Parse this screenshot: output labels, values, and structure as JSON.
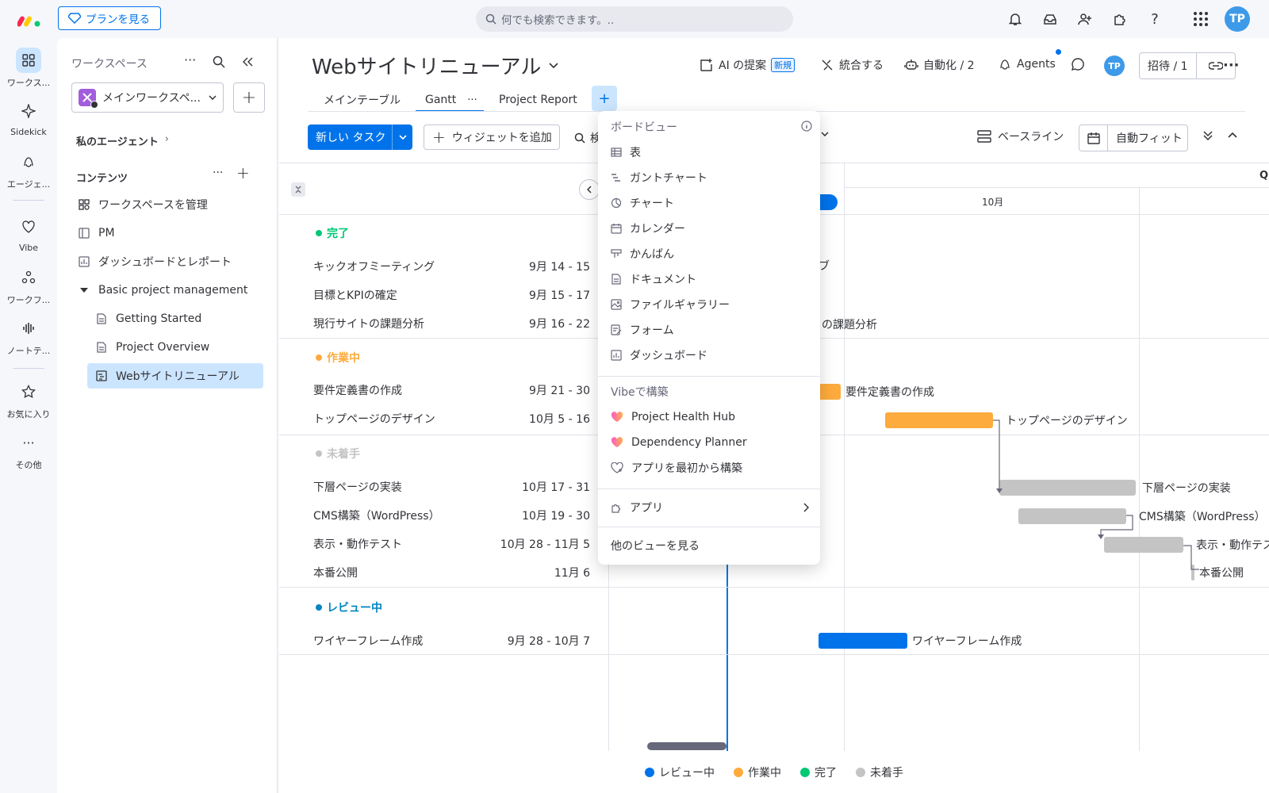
{
  "colors": {
    "accent": "#0073ea",
    "done": "#00c875",
    "working": "#fdab3d",
    "not_started": "#c4c4c4",
    "review": "#0086c0",
    "today_line": "#0073ea"
  },
  "topbar": {
    "plan_label": "プランを見る",
    "search_placeholder": "何でも検索できます。..",
    "avatar": "TP"
  },
  "rail": {
    "items": [
      {
        "label": "ワークス...",
        "icon": "workspace-icon"
      },
      {
        "label": "Sidekick",
        "icon": "sidekick-icon"
      },
      {
        "label": "エージェ...",
        "icon": "agent-icon"
      },
      {
        "label": "Vibe",
        "icon": "vibe-icon"
      },
      {
        "label": "ワークフ...",
        "icon": "workflow-icon"
      },
      {
        "label": "ノートテ...",
        "icon": "notetaker-icon"
      },
      {
        "label": "お気に入り",
        "icon": "star-icon"
      },
      {
        "label": "その他",
        "icon": "more-icon"
      }
    ]
  },
  "sidebar": {
    "title": "ワークスペース",
    "workspace_name": "メインワークスペ...",
    "my_agents": "私のエージェント",
    "content_label": "コンテンツ",
    "items": [
      {
        "label": "ワークスペースを管理",
        "icon": "manage-icon"
      },
      {
        "label": "PM",
        "icon": "board-icon"
      },
      {
        "label": "ダッシュボードとレポート",
        "icon": "dashboard-icon"
      },
      {
        "label": "Basic project management",
        "icon": "caret-down-icon"
      },
      {
        "label": "Getting Started",
        "icon": "doc-icon"
      },
      {
        "label": "Project Overview",
        "icon": "doc-icon"
      },
      {
        "label": "Webサイトリニューアル",
        "icon": "gantt-board-icon"
      }
    ]
  },
  "board": {
    "title": "Webサイトリニューアル",
    "ai_label": "AI の提案",
    "new_badge": "新規",
    "integrate_label": "統合する",
    "automate_label": "自動化 / 2",
    "agents_label": "Agents",
    "invite_label": "招待 / 1",
    "tabs": [
      "メインテーブル",
      "Gantt",
      "Project Report"
    ],
    "new_task": "新しい タスク",
    "add_widget": "ウィジェットを追加",
    "search_partial": "検",
    "baseline": "ベースライン",
    "autofit": "自動フィット",
    "month_label": "10月",
    "quarter_partial": "Q"
  },
  "groups": [
    {
      "name": "完了",
      "color": "#00c875",
      "tasks": [
        {
          "name": "キックオフミーティング",
          "date": "9月 14 - 15",
          "bar_label": "ブ"
        },
        {
          "name": "目標とKPIの確定",
          "date": "9月 15 - 17",
          "bar_label": ""
        },
        {
          "name": "現行サイトの課題分析",
          "date": "9月 16 - 22",
          "bar_label": "トの課題分析"
        }
      ]
    },
    {
      "name": "作業中",
      "color": "#fdab3d",
      "tasks": [
        {
          "name": "要件定義書の作成",
          "date": "9月 21 - 30",
          "bar_label": "要件定義書の作成"
        },
        {
          "name": "トップページのデザイン",
          "date": "10月 5 - 16",
          "bar_label": "トップページのデザイン"
        }
      ]
    },
    {
      "name": "未着手",
      "color": "#c4c4c4",
      "tasks": [
        {
          "name": "下層ページの実装",
          "date": "10月 17 - 31",
          "bar_label": "下層ページの実装"
        },
        {
          "name": "CMS構築（WordPress）",
          "date": "10月 19 - 30",
          "bar_label": "CMS構築（WordPress）"
        },
        {
          "name": "表示・動作テスト",
          "date": "10月 28 - 11月 5",
          "bar_label": "表示・動作テス"
        },
        {
          "name": "本番公開",
          "date": "11月 6",
          "bar_label": "本番公開"
        }
      ]
    },
    {
      "name": "レビュー中",
      "color": "#0086c0",
      "tasks": [
        {
          "name": "ワイヤーフレーム作成",
          "date": "9月 28 - 10月 7",
          "bar_label": "ワイヤーフレーム作成"
        }
      ]
    }
  ],
  "dropdown": {
    "board_views_title": "ボードビュー",
    "views": [
      {
        "label": "表",
        "icon": "table-icon"
      },
      {
        "label": "ガントチャート",
        "icon": "gantt-icon"
      },
      {
        "label": "チャート",
        "icon": "chart-icon"
      },
      {
        "label": "カレンダー",
        "icon": "calendar-icon"
      },
      {
        "label": "かんばん",
        "icon": "kanban-icon"
      },
      {
        "label": "ドキュメント",
        "icon": "document-icon"
      },
      {
        "label": "ファイルギャラリー",
        "icon": "gallery-icon"
      },
      {
        "label": "フォーム",
        "icon": "form-icon"
      },
      {
        "label": "ダッシュボード",
        "icon": "dashboard-icon"
      }
    ],
    "vibe_title": "Vibeで構築",
    "vibe_items": [
      {
        "label": "Project Health Hub",
        "icon": "heart-icon"
      },
      {
        "label": "Dependency Planner",
        "icon": "heart-icon"
      },
      {
        "label": "アプリを最初から構築",
        "icon": "build-app-icon"
      }
    ],
    "apps_label": "アプリ",
    "more_views": "他のビューを見る"
  },
  "legend": [
    {
      "label": "レビュー中",
      "color": "#0086c0"
    },
    {
      "label": "作業中",
      "color": "#fdab3d"
    },
    {
      "label": "完了",
      "color": "#00c875"
    },
    {
      "label": "未着手",
      "color": "#c4c4c4"
    }
  ]
}
